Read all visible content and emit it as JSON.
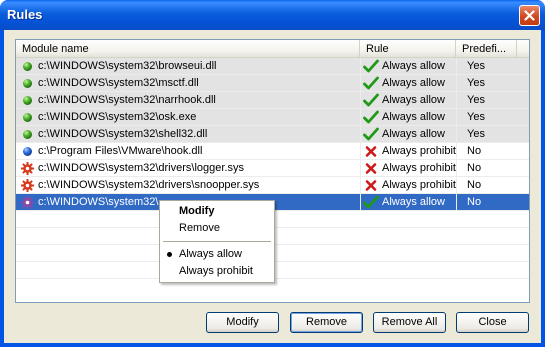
{
  "window": {
    "title": "Rules"
  },
  "columns": {
    "module": "Module name",
    "rule": "Rule",
    "predefined": "Predefi..."
  },
  "rows": [
    {
      "module": "c:\\WINDOWS\\system32\\browseui.dll",
      "rule": "Always allow",
      "predefined": "Yes",
      "module_icon": "green-dot-icon",
      "rule_icon": "checkmark-icon",
      "state": "predef"
    },
    {
      "module": "c:\\WINDOWS\\system32\\msctf.dll",
      "rule": "Always allow",
      "predefined": "Yes",
      "module_icon": "green-dot-icon",
      "rule_icon": "checkmark-icon",
      "state": "predef"
    },
    {
      "module": "c:\\WINDOWS\\system32\\narrhook.dll",
      "rule": "Always allow",
      "predefined": "Yes",
      "module_icon": "green-dot-icon",
      "rule_icon": "checkmark-icon",
      "state": "predef"
    },
    {
      "module": "c:\\WINDOWS\\system32\\osk.exe",
      "rule": "Always allow",
      "predefined": "Yes",
      "module_icon": "green-dot-icon",
      "rule_icon": "checkmark-icon",
      "state": "predef"
    },
    {
      "module": "c:\\WINDOWS\\system32\\shell32.dll",
      "rule": "Always allow",
      "predefined": "Yes",
      "module_icon": "green-dot-icon",
      "rule_icon": "checkmark-icon",
      "state": "predef"
    },
    {
      "module": "c:\\Program Files\\VMware\\hook.dll",
      "rule": "Always prohibit",
      "predefined": "No",
      "module_icon": "blue-dot-icon",
      "rule_icon": "red-x-icon",
      "state": "normal"
    },
    {
      "module": "c:\\WINDOWS\\system32\\drivers\\logger.sys",
      "rule": "Always prohibit",
      "predefined": "No",
      "module_icon": "gear-icon",
      "rule_icon": "red-x-icon",
      "state": "normal"
    },
    {
      "module": "c:\\WINDOWS\\system32\\drivers\\snoopper.sys",
      "rule": "Always prohibit",
      "predefined": "No",
      "module_icon": "gear-icon",
      "rule_icon": "red-x-icon",
      "state": "normal"
    },
    {
      "module": "c:\\WINDOWS\\system32\\",
      "rule": "Always allow",
      "predefined": "No",
      "module_icon": "purple-gear-icon",
      "rule_icon": "checkmark-icon",
      "state": "selected"
    }
  ],
  "context_menu": {
    "modify": "Modify",
    "remove": "Remove",
    "always_allow": "Always allow",
    "always_prohibit": "Always prohibit"
  },
  "buttons": {
    "modify": "Modify",
    "remove": "Remove",
    "remove_all": "Remove All",
    "close": "Close"
  },
  "colors": {
    "titlebar": "#0055e5",
    "selection": "#316ac5",
    "predefined_row": "#e3e3e3",
    "dialog_bg": "#ece9d8"
  }
}
